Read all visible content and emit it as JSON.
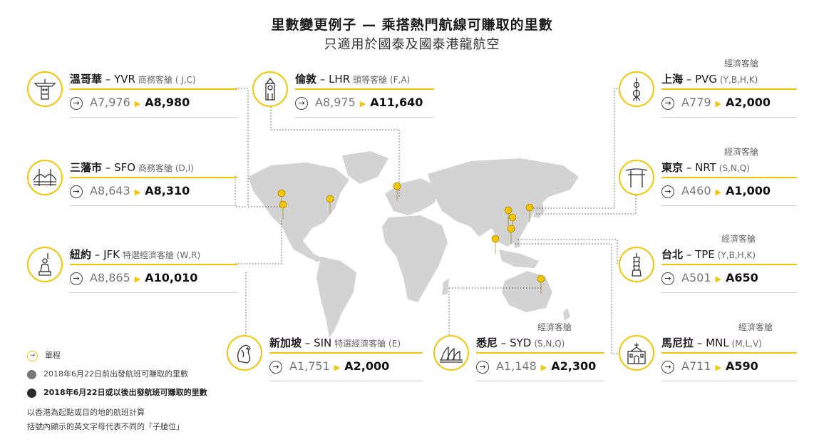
{
  "title": "里數變更例子 — 乘搭熱門航線可賺取的里數",
  "subtitle": "只適用於國泰及國泰港龍航空",
  "currency_symbol": "A",
  "accent_color": "#f5c400",
  "cards": {
    "yvr": {
      "city": "溫哥華",
      "code": "– YVR",
      "cls": "商務客艙 ( J,C)",
      "cabin": "",
      "old": "7,976",
      "new": "8,980",
      "icon": "totem-icon"
    },
    "lhr": {
      "city": "倫敦",
      "code": "– LHR",
      "cls": "頭等客艙 (F,A)",
      "cabin": "",
      "old": "8,975",
      "new": "11,640",
      "icon": "big-ben-icon"
    },
    "pvg": {
      "city": "上海",
      "code": "– PVG",
      "cls": "(Y,B,H,K)",
      "cabin": "經濟客艙",
      "old": "779",
      "new": "2,000",
      "icon": "pearl-tower-icon"
    },
    "sfo": {
      "city": "三藩市",
      "code": "– SFO",
      "cls": "商務客艙 (D,I)",
      "cabin": "",
      "old": "8,643",
      "new": "8,310",
      "icon": "golden-gate-icon"
    },
    "nrt": {
      "city": "東京",
      "code": "– NRT",
      "cls": "(S,N,Q)",
      "cabin": "經濟客艙",
      "old": "460",
      "new": "1,000",
      "icon": "torii-icon"
    },
    "jfk": {
      "city": "紐約",
      "code": "– JFK",
      "cls": "特選經濟客艙 (W,R)",
      "cabin": "",
      "old": "8,865",
      "new": "10,010",
      "icon": "statue-of-liberty-icon"
    },
    "tpe": {
      "city": "台北",
      "code": "– TPE",
      "cls": "(Y,B,H,K)",
      "cabin": "經濟客艙",
      "old": "501",
      "new": "650",
      "icon": "taipei-101-icon"
    },
    "sin": {
      "city": "新加坡",
      "code": "– SIN",
      "cls": "特選經濟客艙 (E)",
      "cabin": "",
      "old": "1,751",
      "new": "2,000",
      "icon": "merlion-icon"
    },
    "syd": {
      "city": "悉尼",
      "code": "– SYD",
      "cls": "(S,N,Q)",
      "cabin": "經濟客艙",
      "old": "1,148",
      "new": "2,300",
      "icon": "opera-house-icon"
    },
    "mnl": {
      "city": "馬尼拉",
      "code": "– MNL",
      "cls": "(M,L,V)",
      "cabin": "經濟客艙",
      "old": "711",
      "new": "590",
      "icon": "church-icon"
    }
  },
  "legend": {
    "one_way": "單程",
    "before": "2018年6月22日前出發航班可賺取的里數",
    "after": "2018年6月22日或以後出發航班可賺取的里數",
    "before_color": "#777777",
    "after_color": "#2b2b2b"
  },
  "notes": {
    "note1": "以香港為起點或目的地的航班計算",
    "note2": "括號內顯示的英文字母代表不同的「子艙位」"
  }
}
